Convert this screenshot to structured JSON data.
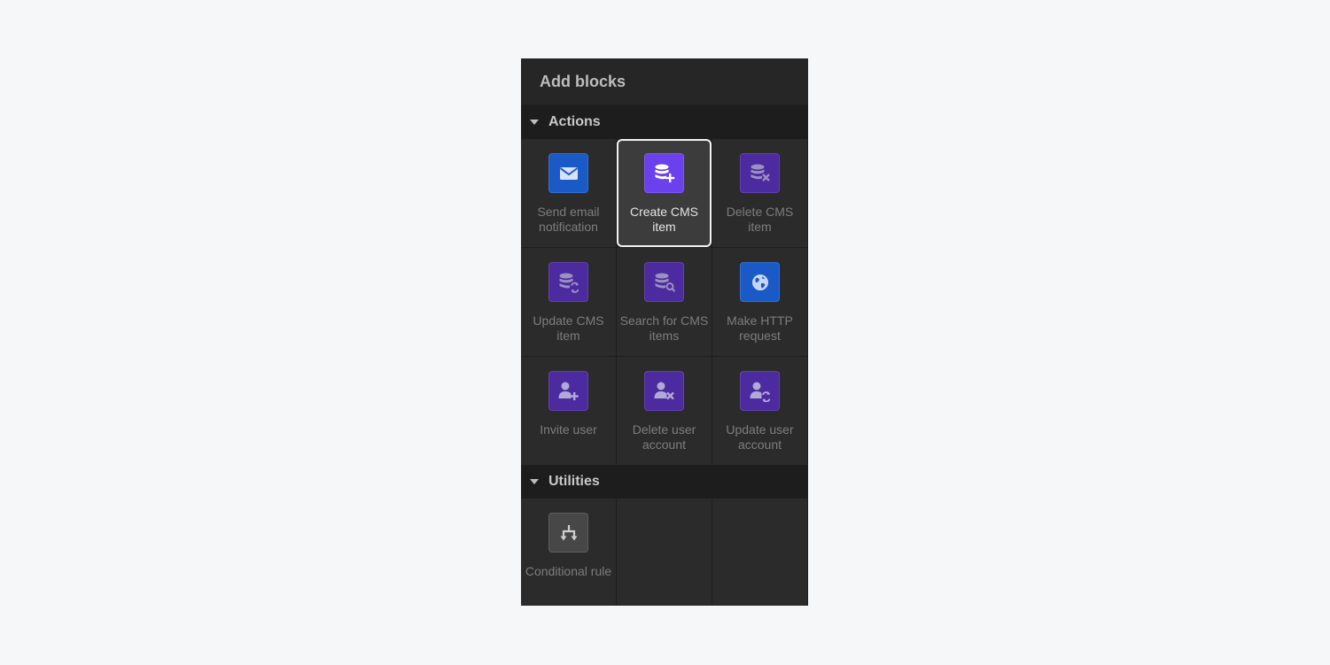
{
  "panel": {
    "title": "Add blocks"
  },
  "sections": {
    "actions": {
      "label": "Actions",
      "items": [
        {
          "label": "Send email notification",
          "icon": "envelope-icon",
          "color": "#1a5ac7"
        },
        {
          "label": "Create CMS item",
          "icon": "database-plus-icon",
          "color": "#6a41ed",
          "selected": true
        },
        {
          "label": "Delete CMS item",
          "icon": "database-x-icon",
          "color": "#4c2a9f"
        },
        {
          "label": "Update CMS item",
          "icon": "database-refresh-icon",
          "color": "#4c2a9f"
        },
        {
          "label": "Search for CMS items",
          "icon": "database-search-icon",
          "color": "#4c2a9f"
        },
        {
          "label": "Make HTTP request",
          "icon": "globe-icon",
          "color": "#1a5ac7"
        },
        {
          "label": "Invite user",
          "icon": "user-plus-icon",
          "color": "#4c2a9f"
        },
        {
          "label": "Delete user account",
          "icon": "user-x-icon",
          "color": "#4c2a9f"
        },
        {
          "label": "Update user account",
          "icon": "user-refresh-icon",
          "color": "#4c2a9f"
        }
      ]
    },
    "utilities": {
      "label": "Utilities",
      "items": [
        {
          "label": "Conditional rule",
          "icon": "branch-icon",
          "color": "#474747"
        }
      ]
    }
  }
}
